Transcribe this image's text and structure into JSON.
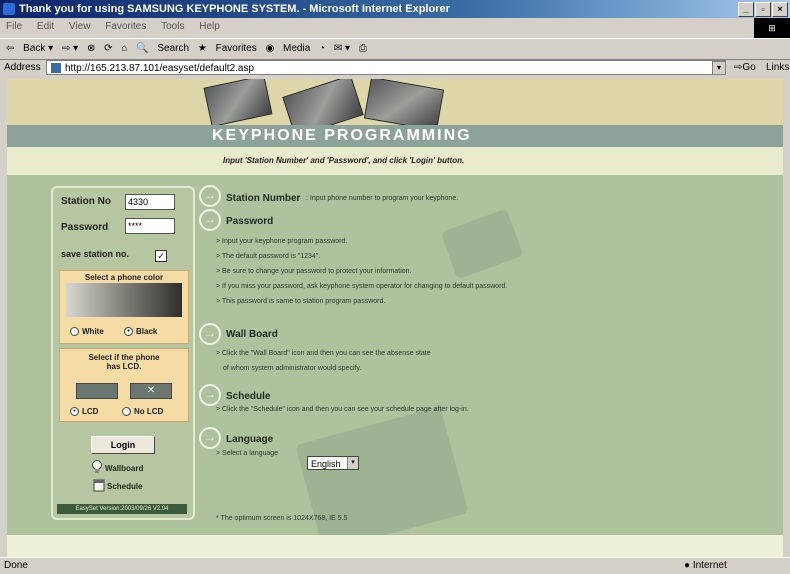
{
  "window": {
    "title": "Thank you for using SAMSUNG KEYPHONE SYSTEM. - Microsoft Internet Explorer"
  },
  "menu": [
    "File",
    "Edit",
    "View",
    "Favorites",
    "Tools",
    "Help"
  ],
  "toolbar": {
    "back": "Back",
    "search": "Search",
    "favorites": "Favorites",
    "media": "Media"
  },
  "address": {
    "label": "Address",
    "url": "http://165.213.87.101/easyset/default2.asp",
    "go": "Go",
    "links": "Links"
  },
  "page": {
    "heading": "KEYPHONE PROGRAMMING",
    "instruction": "Input 'Station Number' and 'Password', and click 'Login' button."
  },
  "login": {
    "station_label": "Station No",
    "station_value": "4330",
    "password_label": "Password",
    "password_value": "****",
    "save_label": "save station no.",
    "color_title": "Select a phone color",
    "white": "White",
    "black": "Black",
    "lcd_title_1": "Select if the phone",
    "lcd_title_2": "has LCD.",
    "lcd": "LCD",
    "no_lcd": "No LCD",
    "login_button": "Login",
    "wallboard": "Wallboard",
    "schedule": "Schedule",
    "version": "EasySet Version:2003/09/26 V2.04"
  },
  "sections": {
    "station": {
      "title": "Station Number",
      "desc": ":  Input phone number to program your keyphone."
    },
    "password": {
      "title": "Password",
      "lines": [
        "> Input your keyphone program password.",
        "> The default password is \"1234\".",
        "> Be sure to change your password to protect your information.",
        "> If you miss your password, ask keyphone system operator for changing to default password.",
        "> This password is same to station program password."
      ]
    },
    "wallboard": {
      "title": "Wall Board",
      "lines": [
        "> Click the \"Wall Board\" icon and then you can see the absense state",
        "of whom system administrator would specify."
      ]
    },
    "schedule": {
      "title": "Schedule",
      "lines": [
        "> Click the \"Schedule\" icon and then you can see your schedule page after log-in."
      ]
    },
    "language": {
      "title": "Language",
      "prompt": "> Select a language",
      "selected": "English"
    },
    "note": "* The optimum screen is 1024X768, IE 5.5"
  },
  "status": {
    "left": "Done",
    "zone": "Internet"
  },
  "icons": {
    "arrow": "right-arrow-circle",
    "wallboard": "lightbulb-icon",
    "schedule": "calendar-icon"
  }
}
